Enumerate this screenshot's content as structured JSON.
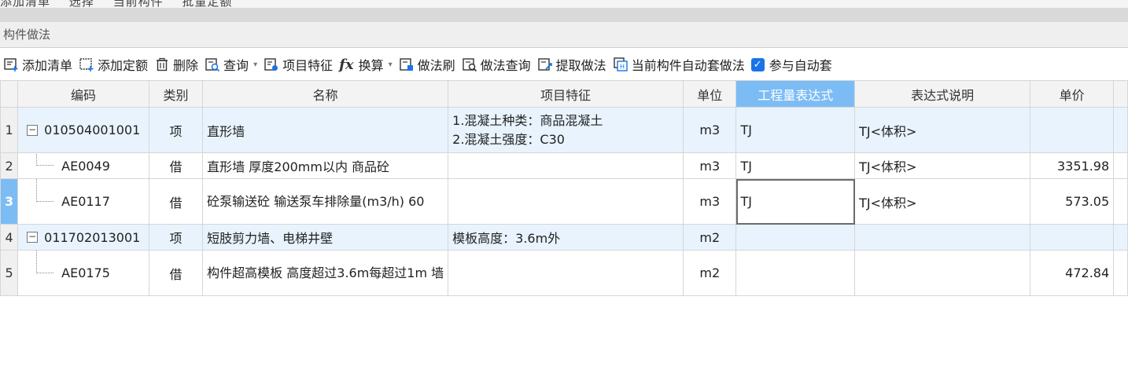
{
  "top_menu": {
    "items": [
      "添加清单",
      "选择",
      "当前构件",
      "批量定额"
    ]
  },
  "panel": {
    "title": "构件做法"
  },
  "toolbar": {
    "add_list": "添加清单",
    "add_quota": "添加定额",
    "delete": "删除",
    "query": "查询",
    "item_feature": "项目特征",
    "convert": "换算",
    "method_brush": "做法刷",
    "method_query": "做法查询",
    "extract_method": "提取做法",
    "auto_apply": "当前构件自动套做法",
    "participate_auto": "参与自动套"
  },
  "grid": {
    "columns": {
      "code": "编码",
      "category": "类别",
      "name": "名称",
      "feature": "项目特征",
      "unit": "单位",
      "expression": "工程量表达式",
      "expr_desc": "表达式说明",
      "price": "单价"
    },
    "rows": [
      {
        "num": "1",
        "code": "010504001001",
        "category": "项",
        "name": "直形墙",
        "feature_line1": "1.混凝土种类：商品混凝土",
        "feature_line2": "2.混凝土强度：C30",
        "unit": "m3",
        "expression": "TJ",
        "expr_desc": "TJ<体积>",
        "price": ""
      },
      {
        "num": "2",
        "code": "AE0049",
        "category": "借",
        "name": "直形墙 厚度200mm以内 商品砼",
        "feature": "",
        "unit": "m3",
        "expression": "TJ",
        "expr_desc": "TJ<体积>",
        "price": "3351.98"
      },
      {
        "num": "3",
        "code": "AE0117",
        "category": "借",
        "name": "砼泵输送砼 输送泵车排除量(m3/h) 60",
        "feature": "",
        "unit": "m3",
        "expression": "TJ",
        "expr_desc": "TJ<体积>",
        "price": "573.05"
      },
      {
        "num": "4",
        "code": "011702013001",
        "category": "项",
        "name": "短肢剪力墙、电梯井壁",
        "feature": "模板高度：3.6m外",
        "unit": "m2",
        "expression": "",
        "expr_desc": "",
        "price": ""
      },
      {
        "num": "5",
        "code": "AE0175",
        "category": "借",
        "name": "构件超高模板 高度超过3.6m每超过1m 墙",
        "feature": "",
        "unit": "m2",
        "expression": "",
        "expr_desc": "",
        "price": "472.84"
      }
    ]
  }
}
